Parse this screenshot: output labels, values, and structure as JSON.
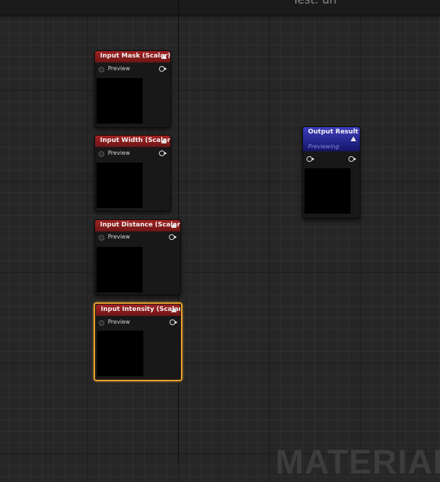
{
  "graph": {
    "title": "Test: un",
    "watermark": "MATERIAL"
  },
  "nodes": [
    {
      "title": "Input Mask (Scalar)",
      "pin_label": "Preview",
      "selected": false
    },
    {
      "title": "Input Width (Scalar)",
      "pin_label": "Preview",
      "selected": false
    },
    {
      "title": "Input Distance (Scalar)",
      "pin_label": "Preview",
      "selected": false
    },
    {
      "title": "Input Intensity (Scalar)",
      "pin_label": "Preview",
      "selected": true
    }
  ],
  "output_node": {
    "title": "Output Result",
    "subtitle": "Previewing"
  },
  "colors": {
    "input_header": "#a32222",
    "output_header": "#2b2ba5",
    "selection": "#e8a22c",
    "canvas": "#262626"
  }
}
